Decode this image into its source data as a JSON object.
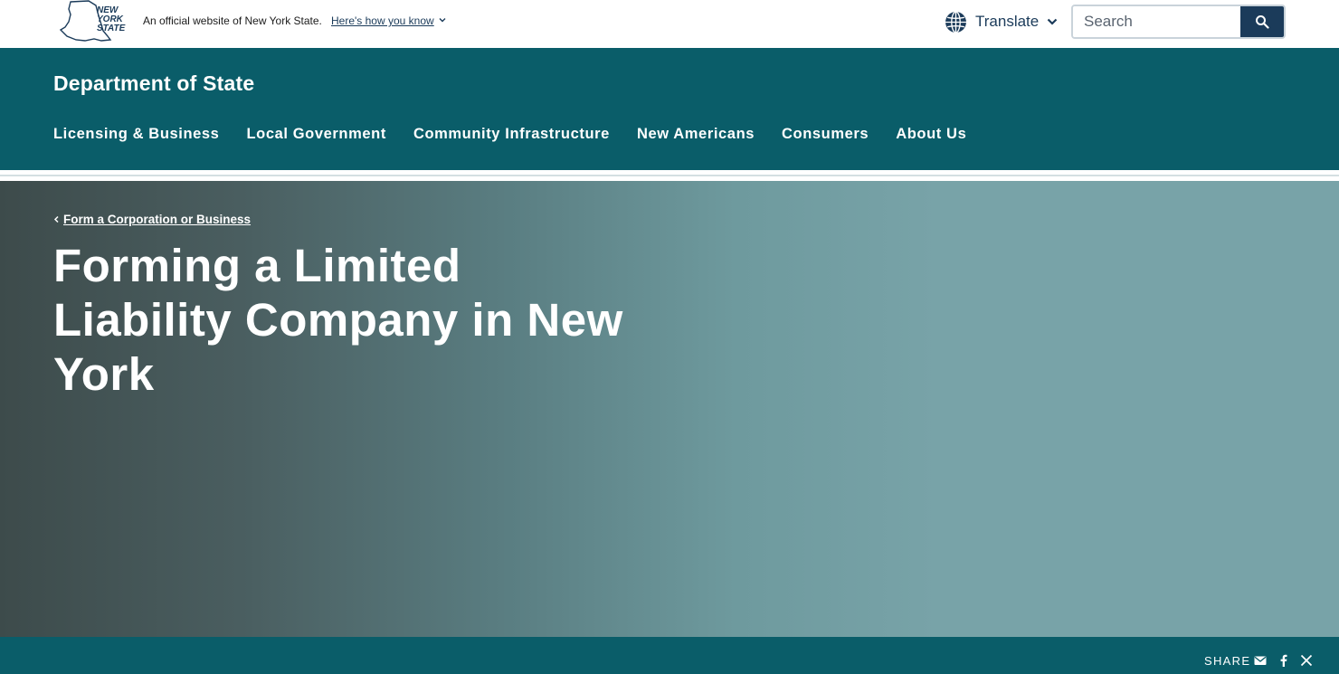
{
  "topbar": {
    "logo_text": [
      "NEW",
      "YORK",
      "STATE"
    ],
    "official_text": "An official website of New York State.",
    "how_know_label": "Here's how you know",
    "translate_label": "Translate",
    "search_placeholder": "Search"
  },
  "agency": {
    "name": "Department of State",
    "nav": [
      {
        "label": "Licensing & Business"
      },
      {
        "label": "Local Government"
      },
      {
        "label": "Community Infrastructure"
      },
      {
        "label": "New Americans"
      },
      {
        "label": "Consumers"
      },
      {
        "label": "About Us"
      }
    ]
  },
  "hero": {
    "breadcrumb_label": "Form a Corporation or Business",
    "title": "Forming a Limited Liability Company in New York"
  },
  "share": {
    "label": "SHARE",
    "icons": [
      "email-icon",
      "facebook-icon",
      "x-icon"
    ]
  },
  "colors": {
    "brand_teal": "#0a5d69",
    "brand_navy": "#1b3b5a"
  }
}
